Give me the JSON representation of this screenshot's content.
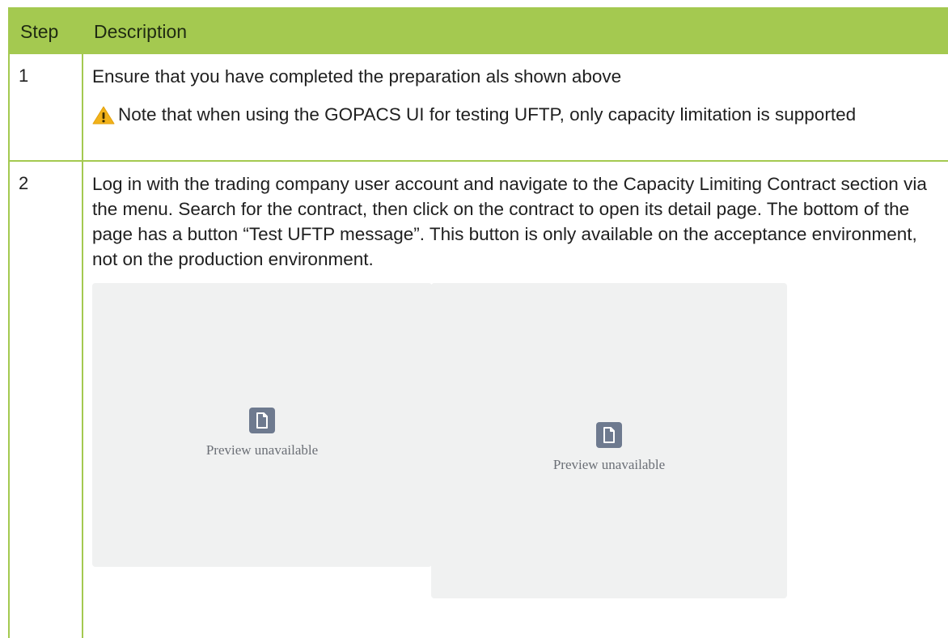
{
  "table": {
    "headers": {
      "step": "Step",
      "description": "Description"
    },
    "rows": [
      {
        "step": "1",
        "description": "Ensure that you have completed the preparation als shown above",
        "note_icon": "warning-icon",
        "note": "Note that when using the GOPACS UI for testing UFTP, only capacity limitation is supported"
      },
      {
        "step": "2",
        "description": "Log in with the trading company user account and navigate to the Capacity Limiting Contract section via the menu. Search for the contract, then click on the contract to open its detail page. The bottom of the page has a button “Test UFTP message”. This button is only available on the acceptance environment, not on the production environment.",
        "previews": [
          {
            "icon": "file-icon",
            "label": "Preview unavailable"
          },
          {
            "icon": "file-icon",
            "label": "Preview unavailable"
          }
        ]
      }
    ]
  },
  "colors": {
    "accent": "#a4c950",
    "preview_bg": "#f0f1f1",
    "icon_bg": "#6e7a8f"
  }
}
